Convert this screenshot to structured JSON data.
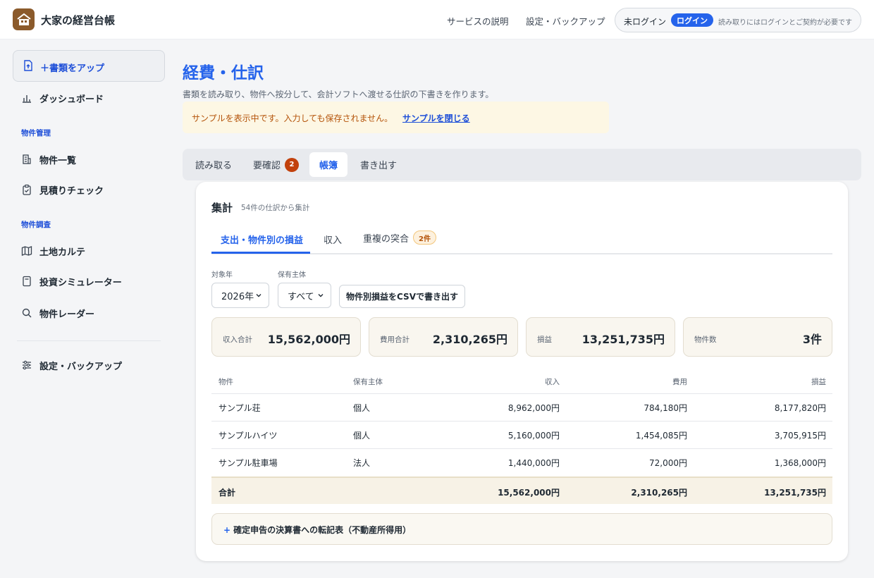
{
  "header": {
    "app_title": "大家の経営台帳",
    "nav": [
      "サービスの説明",
      "設定・バックアップ"
    ],
    "login_status": "未ログイン",
    "login_button": "ログイン",
    "login_note": "読み取りにはログインとご契約が必要です"
  },
  "sidebar": {
    "upload_label": "＋書類をアップ",
    "dashboard": "ダッシュボード",
    "section_property": "物件管理",
    "property_list": "物件一覧",
    "estimate_check": "見積りチェック",
    "section_research": "物件調査",
    "land_chart": "土地カルテ",
    "simulator": "投資シミュレーター",
    "radar": "物件レーダー",
    "settings": "設定・バックアップ"
  },
  "main": {
    "title": "経費・仕訳",
    "description": "書類を読み取り、物件へ按分して、会計ソフトへ渡せる仕訳の下書きを作ります。",
    "notice_text": "サンプルを表示中です。入力しても保存されません。",
    "notice_link": "サンプルを閉じる",
    "tabs": {
      "read": "読み取る",
      "review": "要確認",
      "review_count": "2",
      "ledger": "帳簿",
      "export": "書き出す"
    }
  },
  "summary": {
    "title": "集計",
    "subtitle": "54件の仕訳から集計",
    "subtabs": {
      "pl_by_property": "支出・物件別の損益",
      "income": "収入",
      "duplicates": "重複の突合",
      "duplicates_badge": "2件"
    },
    "filters": {
      "year_label": "対象年",
      "year_value": "2026年",
      "owner_label": "保有主体",
      "owner_value": "すべて",
      "csv_button": "物件別損益をCSVで書き出す"
    },
    "stats": [
      {
        "label": "収入合計",
        "value": "15,562,000円"
      },
      {
        "label": "費用合計",
        "value": "2,310,265円"
      },
      {
        "label": "損益",
        "value": "13,251,735円"
      },
      {
        "label": "物件数",
        "value": "3件"
      }
    ],
    "table": {
      "headers": [
        "物件",
        "保有主体",
        "収入",
        "費用",
        "損益"
      ],
      "rows": [
        [
          "サンプル荘",
          "個人",
          "8,962,000円",
          "784,180円",
          "8,177,820円"
        ],
        [
          "サンプルハイツ",
          "個人",
          "5,160,000円",
          "1,454,085円",
          "3,705,915円"
        ],
        [
          "サンプル駐車場",
          "法人",
          "1,440,000円",
          "72,000円",
          "1,368,000円"
        ]
      ],
      "total": [
        "合計",
        "15,562,000円",
        "2,310,265円",
        "13,251,735円"
      ]
    },
    "expand_label": "確定申告の決算書への転記表（不動産所得用）",
    "expand_plus": "+"
  }
}
